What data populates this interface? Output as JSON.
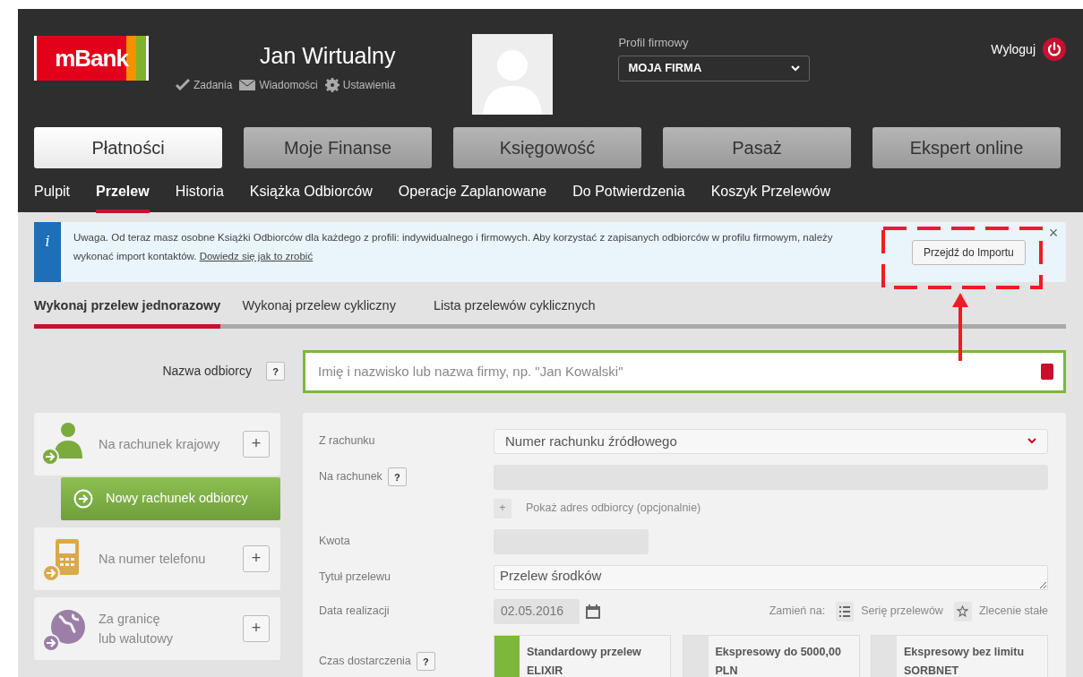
{
  "header": {
    "logo": "mBank",
    "user_name": "Jan Wirtualny",
    "user_links": [
      {
        "label": "Zadania"
      },
      {
        "label": "Wiadomości"
      },
      {
        "label": "Ustawienia"
      }
    ],
    "profile": {
      "label": "Profil firmowy",
      "value": "MOJA FIRMA"
    },
    "logout": "Wyloguj"
  },
  "main_tabs": [
    {
      "label": "Płatności",
      "selected": true
    },
    {
      "label": "Moje Finanse",
      "selected": false
    },
    {
      "label": "Księgowość",
      "selected": false
    },
    {
      "label": "Pasaż",
      "selected": false
    },
    {
      "label": "Ekspert online",
      "selected": false
    }
  ],
  "sub_nav": [
    {
      "label": "Pulpit",
      "selected": false
    },
    {
      "label": "Przelew",
      "selected": true
    },
    {
      "label": "Historia",
      "selected": false
    },
    {
      "label": "Książka Odbiorców",
      "selected": false
    },
    {
      "label": "Operacje Zaplanowane",
      "selected": false
    },
    {
      "label": "Do Potwierdzenia",
      "selected": false
    },
    {
      "label": "Koszyk Przelewów",
      "selected": false
    }
  ],
  "alert": {
    "icon_text": "i",
    "text": "Uwaga. Od teraz masz osobne Książki Odbiorców dla każdego z profili: indywidualnego i firmowych. Aby korzystać z zapisanych odbiorców w profilu firmowym, należy wykonać import kontaktów.",
    "link": "Dowiedz się jak to zrobić",
    "button": "Przejdź do Importu",
    "close": "×"
  },
  "transfer_tabs": [
    {
      "label": "Wykonaj przelew jednorazowy",
      "selected": true
    },
    {
      "label": "Wykonaj przelew cykliczny",
      "selected": false
    },
    {
      "label": "Lista przelewów cyklicznych",
      "selected": false
    }
  ],
  "recipient": {
    "label": "Nazwa odbiorcy",
    "help": "?",
    "placeholder": "Imię i nazwisko lub nazwa firmy, np. \"Jan Kowalski\""
  },
  "transfer_types": [
    {
      "label": "Na rachunek krajowy",
      "color": "#7aab3c",
      "add": "+"
    },
    {
      "label": "Na numer telefonu",
      "color": "#d9a94c",
      "add": "+"
    },
    {
      "label": "Za granicę\nlub walutowy",
      "color": "#9b7fa6",
      "add": "+"
    }
  ],
  "new_account_button": "Nowy rachunek odbiorcy",
  "form": {
    "from_account": {
      "label": "Z rachunku",
      "value": "Numer rachunku źródłowego"
    },
    "to_account": {
      "label": "Na rachunek",
      "help": "?"
    },
    "show_address": {
      "icon_text": "+",
      "label": "Pokaż adres odbiorcy (opcjonalnie)"
    },
    "amount": {
      "label": "Kwota"
    },
    "title": {
      "label": "Tytuł przelewu",
      "value": "Przelew środków"
    },
    "date": {
      "label": "Data realizacji",
      "value": "02.05.2016",
      "convert_label": "Zamień na:",
      "options": [
        {
          "label": "Serię przelewów"
        },
        {
          "label": "Zlecenie stałe"
        }
      ]
    },
    "delivery": {
      "label": "Czas dostarczenia",
      "help": "?",
      "options": [
        {
          "title": "Standardowy przelew\nELIXIR",
          "selected": true
        },
        {
          "title": "Ekspresowy do 5000,00\nPLN",
          "selected": false
        },
        {
          "title": "Ekspresowy bez limitu\nSORBNET",
          "selected": false
        }
      ]
    }
  }
}
